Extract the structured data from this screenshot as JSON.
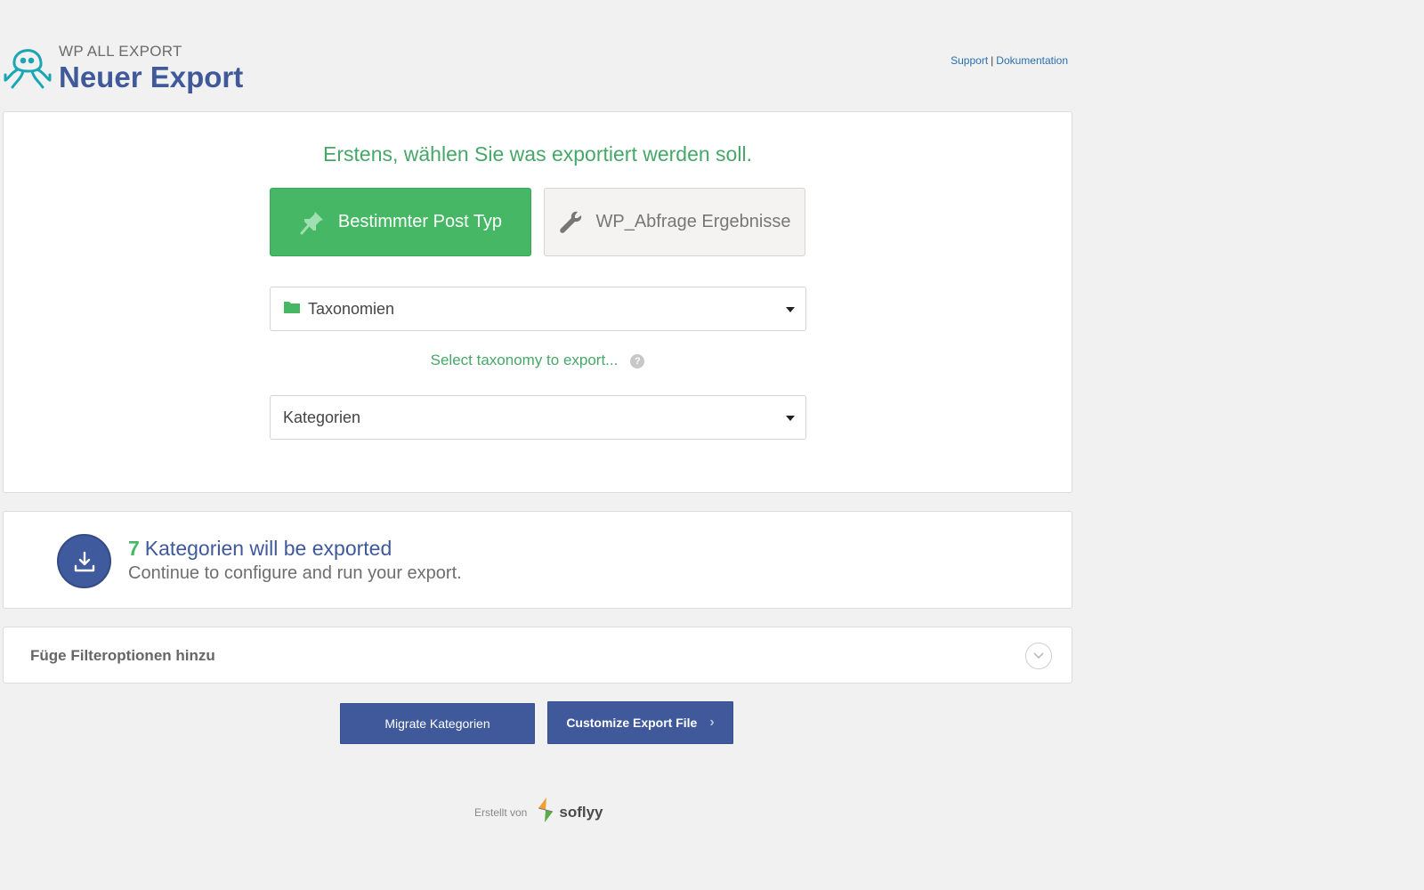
{
  "brand": {
    "small": "WP ALL EXPORT",
    "title": "Neuer Export"
  },
  "links": {
    "support": "Support",
    "separator": "|",
    "docs": "Dokumentation"
  },
  "main": {
    "heading": "Erstens, wählen Sie was exportiert werden soll.",
    "specific_post_type": "Bestimmter Post Typ",
    "wp_query": "WP_Abfrage Ergebnisse",
    "post_type_select": "Taxonomien",
    "helper": "Select taxonomy to export...",
    "help_icon": "?",
    "taxonomy_select": "Kategorien"
  },
  "count": {
    "number": "7",
    "line1": "Kategorien will be exported",
    "line2": "Continue to configure and run your export."
  },
  "filter": {
    "label": "Füge Filteroptionen hinzu"
  },
  "actions": {
    "migrate": "Migrate Kategorien",
    "customize": "Customize Export File",
    "arrow": "›"
  },
  "footer": {
    "created_by": "Erstellt von",
    "brand": "soflyy"
  },
  "colors": {
    "accent_green": "#46b865",
    "brand_blue": "#40599b",
    "link": "#2a6fb0"
  },
  "icons": [
    "octopus-logo-icon",
    "pin-icon",
    "wrench-icon",
    "folder-icon",
    "help-icon",
    "download-icon",
    "chevron-down-icon",
    "chevron-right-icon",
    "soflyy-logo-icon"
  ]
}
